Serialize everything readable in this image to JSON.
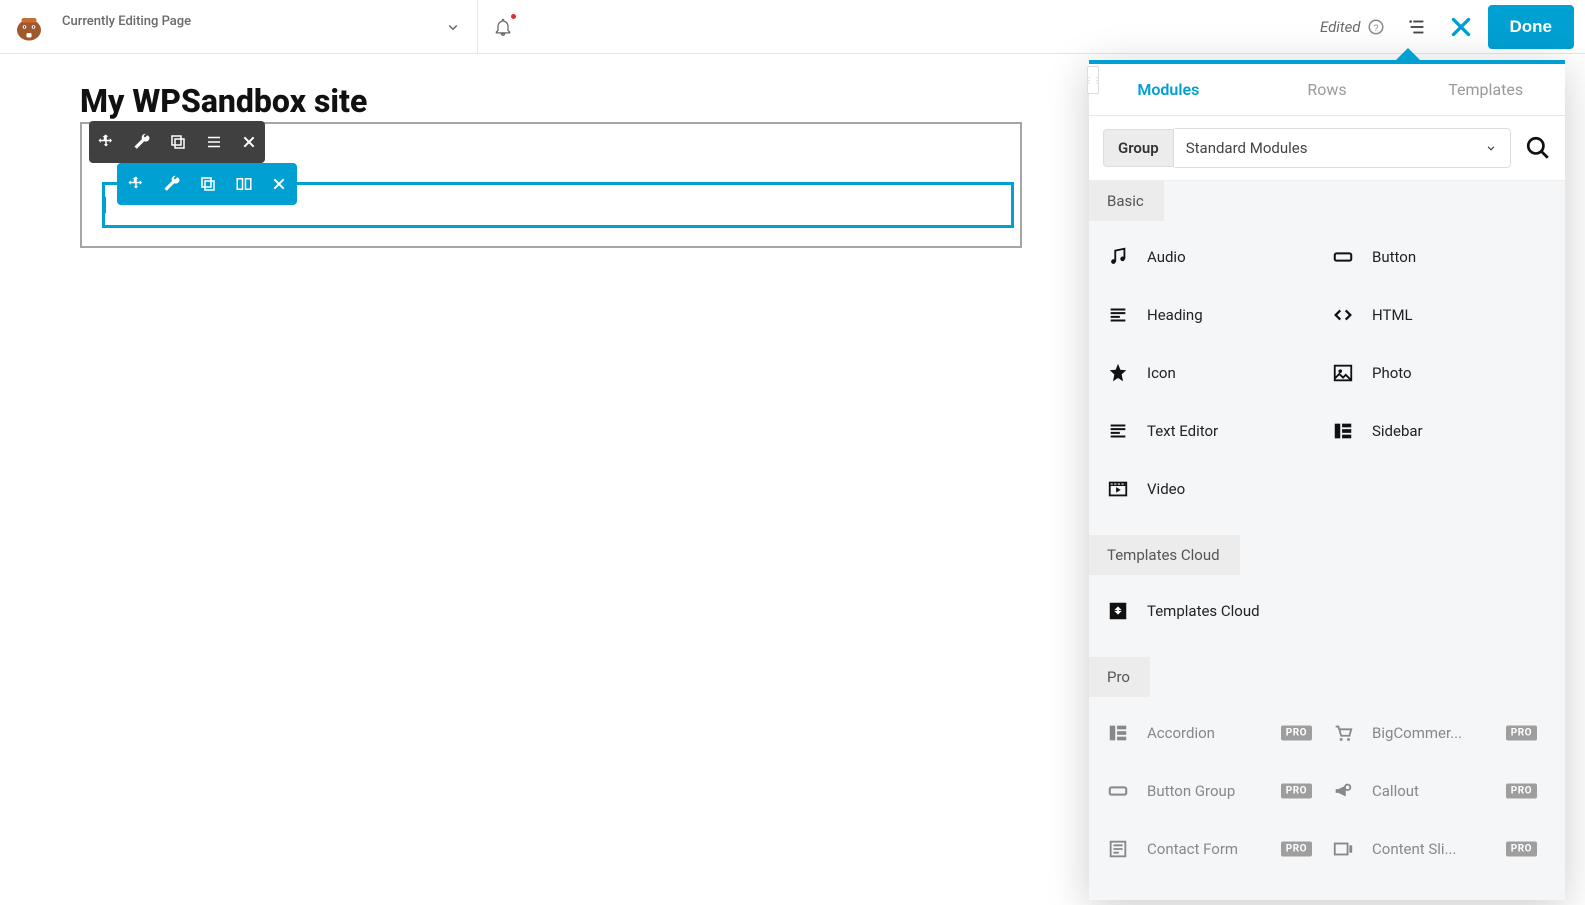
{
  "topbar": {
    "editing_label": "Currently Editing Page",
    "edited_label": "Edited",
    "done_label": "Done"
  },
  "canvas": {
    "page_title": "My WPSandbox site"
  },
  "panel": {
    "tabs": [
      "Modules",
      "Rows",
      "Templates"
    ],
    "active_tab": "Modules",
    "group_label": "Group",
    "filter_value": "Standard Modules",
    "sections": {
      "basic": {
        "title": "Basic",
        "items": [
          {
            "label": "Audio",
            "icon": "music"
          },
          {
            "label": "Button",
            "icon": "button"
          },
          {
            "label": "Heading",
            "icon": "text-lines"
          },
          {
            "label": "HTML",
            "icon": "code"
          },
          {
            "label": "Icon",
            "icon": "star"
          },
          {
            "label": "Photo",
            "icon": "photo"
          },
          {
            "label": "Text Editor",
            "icon": "text-lines"
          },
          {
            "label": "Sidebar",
            "icon": "sidebar"
          },
          {
            "label": "Video",
            "icon": "video"
          }
        ]
      },
      "templates_cloud": {
        "title": "Templates Cloud",
        "items": [
          {
            "label": "Templates Cloud",
            "icon": "cloud"
          }
        ]
      },
      "pro": {
        "title": "Pro",
        "items": [
          {
            "label": "Accordion",
            "icon": "sidebar",
            "pro": true
          },
          {
            "label": "BigCommer...",
            "icon": "cart",
            "pro": true
          },
          {
            "label": "Button Group",
            "icon": "button",
            "pro": true
          },
          {
            "label": "Callout",
            "icon": "bullhorn",
            "pro": true
          },
          {
            "label": "Contact Form",
            "icon": "form",
            "pro": true
          },
          {
            "label": "Content Sli...",
            "icon": "slider",
            "pro": true
          }
        ]
      }
    }
  }
}
